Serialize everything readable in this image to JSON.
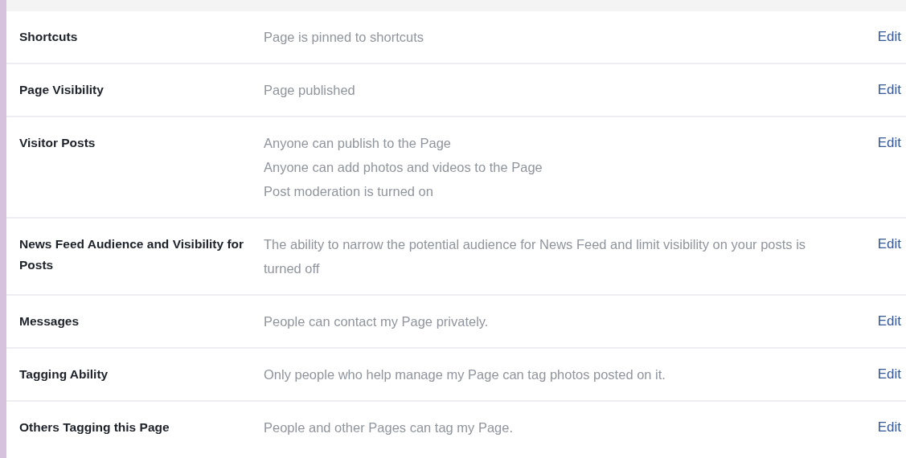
{
  "settings": [
    {
      "label": "Shortcuts",
      "lines": [
        "Page is pinned to shortcuts"
      ],
      "action": "Edit"
    },
    {
      "label": "Page Visibility",
      "lines": [
        "Page published"
      ],
      "action": "Edit"
    },
    {
      "label": "Visitor Posts",
      "lines": [
        "Anyone can publish to the Page",
        "Anyone can add photos and videos to the Page",
        "Post moderation is turned on"
      ],
      "action": "Edit"
    },
    {
      "label": "News Feed Audience and Visibility for Posts",
      "lines": [
        "The ability to narrow the potential audience for News Feed and limit visibility on your posts is turned off"
      ],
      "action": "Edit"
    },
    {
      "label": "Messages",
      "lines": [
        "People can contact my Page privately."
      ],
      "action": "Edit"
    },
    {
      "label": "Tagging Ability",
      "lines": [
        "Only people who help manage my Page can tag photos posted on it."
      ],
      "action": "Edit"
    },
    {
      "label": "Others Tagging this Page",
      "lines": [
        "People and other Pages can tag my Page."
      ],
      "action": "Edit"
    }
  ]
}
